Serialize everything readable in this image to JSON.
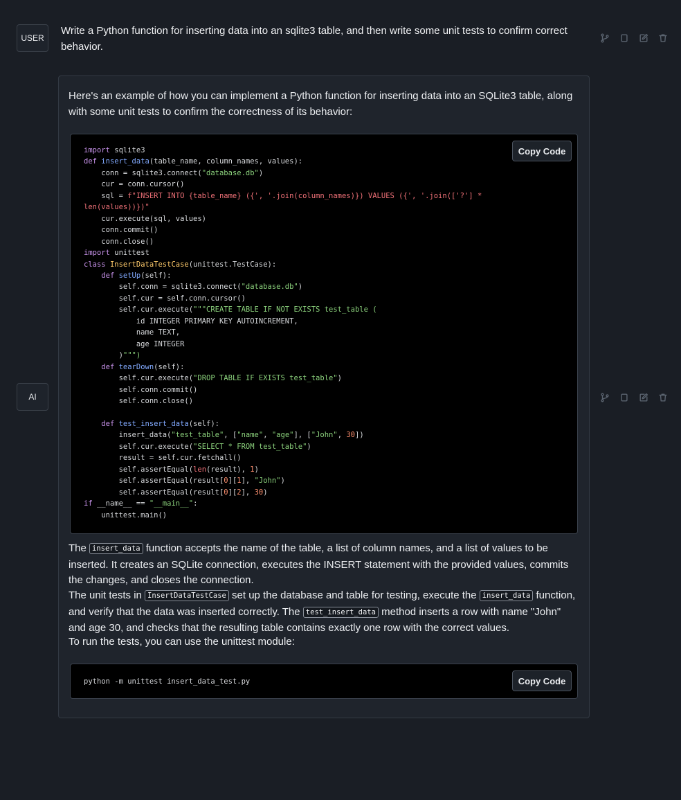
{
  "user_message": {
    "role_label": "USER",
    "text": "Write a Python function for inserting data into an sqlite3 table, and then write some unit tests to confirm correct behavior."
  },
  "ai_message": {
    "role_label": "AI",
    "intro": "Here's an example of how you can implement a Python function for inserting data into an SQLite3 table, along with some unit tests to confirm the correctness of its behavior:",
    "copy_label": "Copy Code",
    "code_lines": [
      "import sqlite3",
      "def insert_data(table_name, column_names, values):",
      "    conn = sqlite3.connect(\"database.db\")",
      "    cur = conn.cursor()",
      "    sql = f\"INSERT INTO {table_name} ({', '.join(column_names)}) VALUES ({', '.join(['?'] *",
      "len(values))})\"",
      "    cur.execute(sql, values)",
      "    conn.commit()",
      "    conn.close()",
      "import unittest",
      "class InsertDataTestCase(unittest.TestCase):",
      "    def setUp(self):",
      "        self.conn = sqlite3.connect(\"database.db\")",
      "        self.cur = self.conn.cursor()",
      "        self.cur.execute(\"\"\"CREATE TABLE IF NOT EXISTS test_table (",
      "            id INTEGER PRIMARY KEY AUTOINCREMENT,",
      "            name TEXT,",
      "            age INTEGER",
      "        )\"\"\")",
      "    def tearDown(self):",
      "        self.cur.execute(\"DROP TABLE IF EXISTS test_table\")",
      "        self.conn.commit()",
      "        self.conn.close()",
      "",
      "    def test_insert_data(self):",
      "        insert_data(\"test_table\", [\"name\", \"age\"], [\"John\", 30])",
      "        self.cur.execute(\"SELECT * FROM test_table\")",
      "        result = self.cur.fetchall()",
      "        self.assertEqual(len(result), 1)",
      "        self.assertEqual(result[0][1], \"John\")",
      "        self.assertEqual(result[0][2], 30)",
      "if __name__ == \"__main__\":",
      "    unittest.main()"
    ],
    "para1": {
      "before": "The ",
      "code": "insert_data",
      "after": " function accepts the name of the table, a list of column names, and a list of values to be inserted. It creates an SQLite connection, executes the INSERT statement with the provided values, commits the changes, and closes the connection."
    },
    "para2": {
      "t1": "The unit tests in ",
      "c1": "InsertDataTestCase",
      "t2": " set up the database and table for testing, execute the ",
      "c2": "insert_data",
      "t3": " function, and verify that the data was inserted correctly. The ",
      "c3": "test_insert_data",
      "t4": " method inserts a row with name \"John\" and age 30, and checks that the resulting table contains exactly one row with the correct values."
    },
    "para3": "To run the tests, you can use the unittest module:",
    "command": "python -m unittest insert_data_test.py",
    "copy_label_2": "Copy Code"
  },
  "icons": [
    "branch-icon",
    "copy-icon",
    "edit-icon",
    "trash-icon"
  ]
}
